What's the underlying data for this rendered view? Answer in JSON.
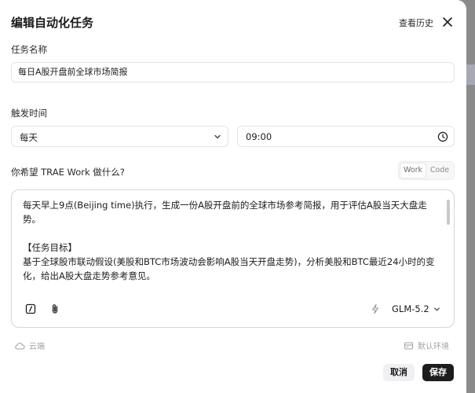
{
  "dialog": {
    "title": "编辑自动化任务",
    "history_link": "查看历史",
    "close_icon": "close-icon"
  },
  "task_name": {
    "label": "任务名称",
    "value": "每日A股开盘前全球市场简报"
  },
  "trigger": {
    "label": "触发时间",
    "frequency": "每天",
    "time": "09:00"
  },
  "prompt": {
    "label": "你希望 TRAE Work 做什么?",
    "modes": [
      "Work",
      "Code"
    ],
    "active_mode": "Work",
    "text": "每天早上9点(Beijing time)执行，生成一份A股开盘前的全球市场参考简报，用于评估A股当天大盘走势。\n\n【任务目标】\n基于全球股市联动假设(美股和BTC市场波动会影响A股当天开盘走势)，分析美股和BTC最近24小时的变化，给出A股大盘走势参考意见。",
    "model": "GLM-5.2",
    "icons": [
      "slash-command-icon",
      "attachment-icon",
      "lightning-icon",
      "chevron-down-icon"
    ]
  },
  "footer": {
    "location": "云端",
    "environment": "默认环境",
    "cancel_label": "取消",
    "save_label": "保存"
  }
}
